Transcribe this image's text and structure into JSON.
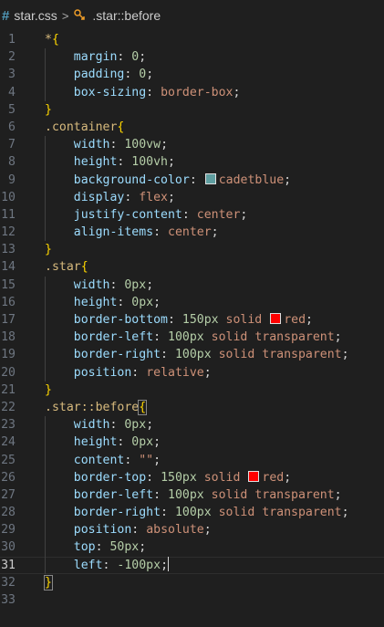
{
  "breadcrumb": {
    "file": "star.css",
    "separator": ">",
    "symbol": ".star::before"
  },
  "colors": {
    "background": "#1f1f1f",
    "selector": "#d7ba7d",
    "brace": "#ffd700",
    "property": "#9cdcfe",
    "number": "#b5cea8",
    "string_value": "#ce9178",
    "swatch_cadetblue": "#5f9ea0",
    "swatch_red": "#ff0000"
  },
  "editor": {
    "current_line": 31,
    "lines": [
      {
        "n": "1",
        "tokens": [
          {
            "t": "*",
            "c": "sel"
          },
          {
            "t": "{",
            "c": "brace"
          }
        ]
      },
      {
        "n": "2",
        "tokens": [
          {
            "t": "    "
          },
          {
            "t": "margin",
            "c": "prop"
          },
          {
            "t": ": "
          },
          {
            "t": "0",
            "c": "num"
          },
          {
            "t": ";"
          }
        ]
      },
      {
        "n": "3",
        "tokens": [
          {
            "t": "    "
          },
          {
            "t": "padding",
            "c": "prop"
          },
          {
            "t": ": "
          },
          {
            "t": "0",
            "c": "num"
          },
          {
            "t": ";"
          }
        ]
      },
      {
        "n": "4",
        "tokens": [
          {
            "t": "    "
          },
          {
            "t": "box-sizing",
            "c": "prop"
          },
          {
            "t": ": "
          },
          {
            "t": "border-box",
            "c": "val"
          },
          {
            "t": ";"
          }
        ]
      },
      {
        "n": "5",
        "tokens": [
          {
            "t": "}",
            "c": "brace"
          }
        ]
      },
      {
        "n": "6",
        "tokens": [
          {
            "t": ".container",
            "c": "sel"
          },
          {
            "t": "{",
            "c": "brace"
          }
        ]
      },
      {
        "n": "7",
        "tokens": [
          {
            "t": "    "
          },
          {
            "t": "width",
            "c": "prop"
          },
          {
            "t": ": "
          },
          {
            "t": "100vw",
            "c": "num"
          },
          {
            "t": ";"
          }
        ]
      },
      {
        "n": "8",
        "tokens": [
          {
            "t": "    "
          },
          {
            "t": "height",
            "c": "prop"
          },
          {
            "t": ": "
          },
          {
            "t": "100vh",
            "c": "num"
          },
          {
            "t": ";"
          }
        ]
      },
      {
        "n": "9",
        "tokens": [
          {
            "t": "    "
          },
          {
            "t": "background-color",
            "c": "prop"
          },
          {
            "t": ": "
          },
          {
            "swatch": "#5f9ea0"
          },
          {
            "t": "cadetblue",
            "c": "val"
          },
          {
            "t": ";"
          }
        ]
      },
      {
        "n": "10",
        "tokens": [
          {
            "t": "    "
          },
          {
            "t": "display",
            "c": "prop"
          },
          {
            "t": ": "
          },
          {
            "t": "flex",
            "c": "val"
          },
          {
            "t": ";"
          }
        ]
      },
      {
        "n": "11",
        "tokens": [
          {
            "t": "    "
          },
          {
            "t": "justify-content",
            "c": "prop"
          },
          {
            "t": ": "
          },
          {
            "t": "center",
            "c": "val"
          },
          {
            "t": ";"
          }
        ]
      },
      {
        "n": "12",
        "tokens": [
          {
            "t": "    "
          },
          {
            "t": "align-items",
            "c": "prop"
          },
          {
            "t": ": "
          },
          {
            "t": "center",
            "c": "val"
          },
          {
            "t": ";"
          }
        ]
      },
      {
        "n": "13",
        "tokens": [
          {
            "t": "}",
            "c": "brace"
          }
        ]
      },
      {
        "n": "14",
        "tokens": [
          {
            "t": ".star",
            "c": "sel"
          },
          {
            "t": "{",
            "c": "brace"
          }
        ]
      },
      {
        "n": "15",
        "tokens": [
          {
            "t": "    "
          },
          {
            "t": "width",
            "c": "prop"
          },
          {
            "t": ": "
          },
          {
            "t": "0px",
            "c": "num"
          },
          {
            "t": ";"
          }
        ]
      },
      {
        "n": "16",
        "tokens": [
          {
            "t": "    "
          },
          {
            "t": "height",
            "c": "prop"
          },
          {
            "t": ": "
          },
          {
            "t": "0px",
            "c": "num"
          },
          {
            "t": ";"
          }
        ]
      },
      {
        "n": "17",
        "tokens": [
          {
            "t": "    "
          },
          {
            "t": "border-bottom",
            "c": "prop"
          },
          {
            "t": ": "
          },
          {
            "t": "150px",
            "c": "num"
          },
          {
            "t": " "
          },
          {
            "t": "solid",
            "c": "val"
          },
          {
            "t": " "
          },
          {
            "swatch": "#ff0000"
          },
          {
            "t": "red",
            "c": "val"
          },
          {
            "t": ";"
          }
        ]
      },
      {
        "n": "18",
        "tokens": [
          {
            "t": "    "
          },
          {
            "t": "border-left",
            "c": "prop"
          },
          {
            "t": ": "
          },
          {
            "t": "100px",
            "c": "num"
          },
          {
            "t": " "
          },
          {
            "t": "solid",
            "c": "val"
          },
          {
            "t": " "
          },
          {
            "t": "transparent",
            "c": "val"
          },
          {
            "t": ";"
          }
        ]
      },
      {
        "n": "19",
        "tokens": [
          {
            "t": "    "
          },
          {
            "t": "border-right",
            "c": "prop"
          },
          {
            "t": ": "
          },
          {
            "t": "100px",
            "c": "num"
          },
          {
            "t": " "
          },
          {
            "t": "solid",
            "c": "val"
          },
          {
            "t": " "
          },
          {
            "t": "transparent",
            "c": "val"
          },
          {
            "t": ";"
          }
        ]
      },
      {
        "n": "20",
        "tokens": [
          {
            "t": "    "
          },
          {
            "t": "position",
            "c": "prop"
          },
          {
            "t": ": "
          },
          {
            "t": "relative",
            "c": "val"
          },
          {
            "t": ";"
          }
        ]
      },
      {
        "n": "21",
        "tokens": [
          {
            "t": "}",
            "c": "brace"
          }
        ]
      },
      {
        "n": "22",
        "tokens": [
          {
            "t": ".star::before",
            "c": "sel"
          },
          {
            "t": "{",
            "c": "brace active"
          }
        ]
      },
      {
        "n": "23",
        "tokens": [
          {
            "t": "    "
          },
          {
            "t": "width",
            "c": "prop"
          },
          {
            "t": ": "
          },
          {
            "t": "0px",
            "c": "num"
          },
          {
            "t": ";"
          }
        ]
      },
      {
        "n": "24",
        "tokens": [
          {
            "t": "    "
          },
          {
            "t": "height",
            "c": "prop"
          },
          {
            "t": ": "
          },
          {
            "t": "0px",
            "c": "num"
          },
          {
            "t": ";"
          }
        ]
      },
      {
        "n": "25",
        "tokens": [
          {
            "t": "    "
          },
          {
            "t": "content",
            "c": "prop"
          },
          {
            "t": ": "
          },
          {
            "t": "\"\"",
            "c": "val"
          },
          {
            "t": ";"
          }
        ]
      },
      {
        "n": "26",
        "tokens": [
          {
            "t": "    "
          },
          {
            "t": "border-top",
            "c": "prop"
          },
          {
            "t": ": "
          },
          {
            "t": "150px",
            "c": "num"
          },
          {
            "t": " "
          },
          {
            "t": "solid",
            "c": "val"
          },
          {
            "t": " "
          },
          {
            "swatch": "#ff0000"
          },
          {
            "t": "red",
            "c": "val"
          },
          {
            "t": ";"
          }
        ]
      },
      {
        "n": "27",
        "tokens": [
          {
            "t": "    "
          },
          {
            "t": "border-left",
            "c": "prop"
          },
          {
            "t": ": "
          },
          {
            "t": "100px",
            "c": "num"
          },
          {
            "t": " "
          },
          {
            "t": "solid",
            "c": "val"
          },
          {
            "t": " "
          },
          {
            "t": "transparent",
            "c": "val"
          },
          {
            "t": ";"
          }
        ]
      },
      {
        "n": "28",
        "tokens": [
          {
            "t": "    "
          },
          {
            "t": "border-right",
            "c": "prop"
          },
          {
            "t": ": "
          },
          {
            "t": "100px",
            "c": "num"
          },
          {
            "t": " "
          },
          {
            "t": "solid",
            "c": "val"
          },
          {
            "t": " "
          },
          {
            "t": "transparent",
            "c": "val"
          },
          {
            "t": ";"
          }
        ]
      },
      {
        "n": "29",
        "tokens": [
          {
            "t": "    "
          },
          {
            "t": "position",
            "c": "prop"
          },
          {
            "t": ": "
          },
          {
            "t": "absolute",
            "c": "val"
          },
          {
            "t": ";"
          }
        ]
      },
      {
        "n": "30",
        "tokens": [
          {
            "t": "    "
          },
          {
            "t": "top",
            "c": "prop"
          },
          {
            "t": ": "
          },
          {
            "t": "50px",
            "c": "num"
          },
          {
            "t": ";"
          }
        ]
      },
      {
        "n": "31",
        "tokens": [
          {
            "t": "    "
          },
          {
            "t": "left",
            "c": "prop"
          },
          {
            "t": ": "
          },
          {
            "t": "-100px",
            "c": "num"
          },
          {
            "t": ";"
          },
          {
            "caret": true
          }
        ]
      },
      {
        "n": "32",
        "tokens": [
          {
            "t": "}",
            "c": "brace active"
          }
        ]
      },
      {
        "n": "33",
        "tokens": []
      }
    ]
  }
}
